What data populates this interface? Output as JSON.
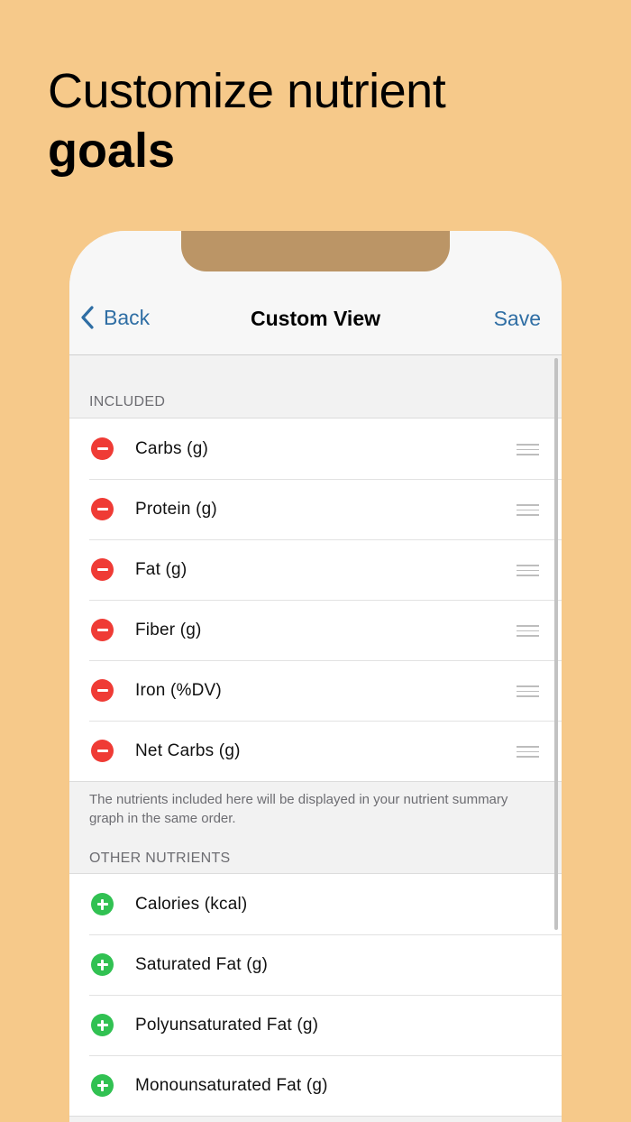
{
  "headline": {
    "line1": "Customize nutrient",
    "line2": "goals"
  },
  "navbar": {
    "back_label": "Back",
    "title": "Custom View",
    "save_label": "Save"
  },
  "included": {
    "header": "INCLUDED",
    "items": [
      {
        "label": "Carbs (g)"
      },
      {
        "label": "Protein (g)"
      },
      {
        "label": "Fat (g)"
      },
      {
        "label": "Fiber (g)"
      },
      {
        "label": "Iron (%DV)"
      },
      {
        "label": "Net Carbs (g)"
      }
    ],
    "footer": "The nutrients included here will be displayed in your nutrient summary graph in the same order."
  },
  "other": {
    "header": "OTHER NUTRIENTS",
    "items": [
      {
        "label": "Calories (kcal)"
      },
      {
        "label": "Saturated Fat (g)"
      },
      {
        "label": "Polyunsaturated Fat (g)"
      },
      {
        "label": "Monounsaturated Fat (g)"
      }
    ]
  },
  "colors": {
    "background": "#f6c98a",
    "accent": "#2f6ea4",
    "remove": "#ef3b35",
    "add": "#31c152",
    "notch": "#bb9566"
  },
  "icons": {
    "back": "chevron-left-icon",
    "remove": "minus-circle-icon",
    "add": "plus-circle-icon",
    "reorder": "reorder-grip-icon"
  }
}
